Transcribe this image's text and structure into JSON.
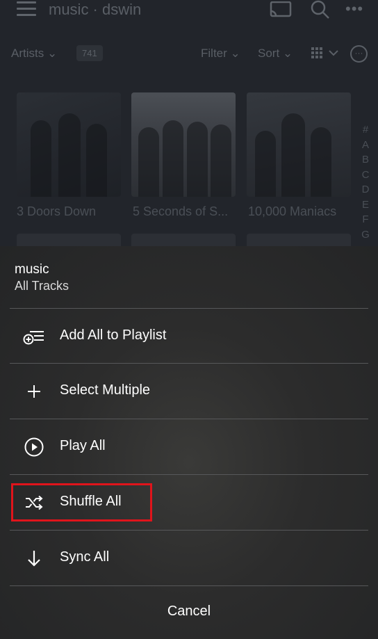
{
  "background": {
    "app_title": "music · dswin",
    "artists_label": "Artists",
    "artist_count": "741",
    "filter_label": "Filter",
    "sort_label": "Sort",
    "artists": [
      {
        "name": "3 Doors Down"
      },
      {
        "name": "5 Seconds of S..."
      },
      {
        "name": "10,000 Maniacs"
      }
    ],
    "alphabet": [
      "#",
      "A",
      "B",
      "C",
      "D",
      "E",
      "F",
      "G"
    ]
  },
  "sheet": {
    "title": "music",
    "subtitle": "All Tracks",
    "items": [
      {
        "label": "Add All to Playlist",
        "icon": "add-to-playlist-icon"
      },
      {
        "label": "Select Multiple",
        "icon": "plus-icon"
      },
      {
        "label": "Play All",
        "icon": "play-circle-icon"
      },
      {
        "label": "Shuffle All",
        "icon": "shuffle-icon"
      },
      {
        "label": "Sync All",
        "icon": "download-arrow-icon"
      }
    ],
    "cancel_label": "Cancel"
  },
  "colors": {
    "highlight": "#e0141b",
    "sheet_background": "#2c2c2c",
    "divider": "#57585a"
  }
}
